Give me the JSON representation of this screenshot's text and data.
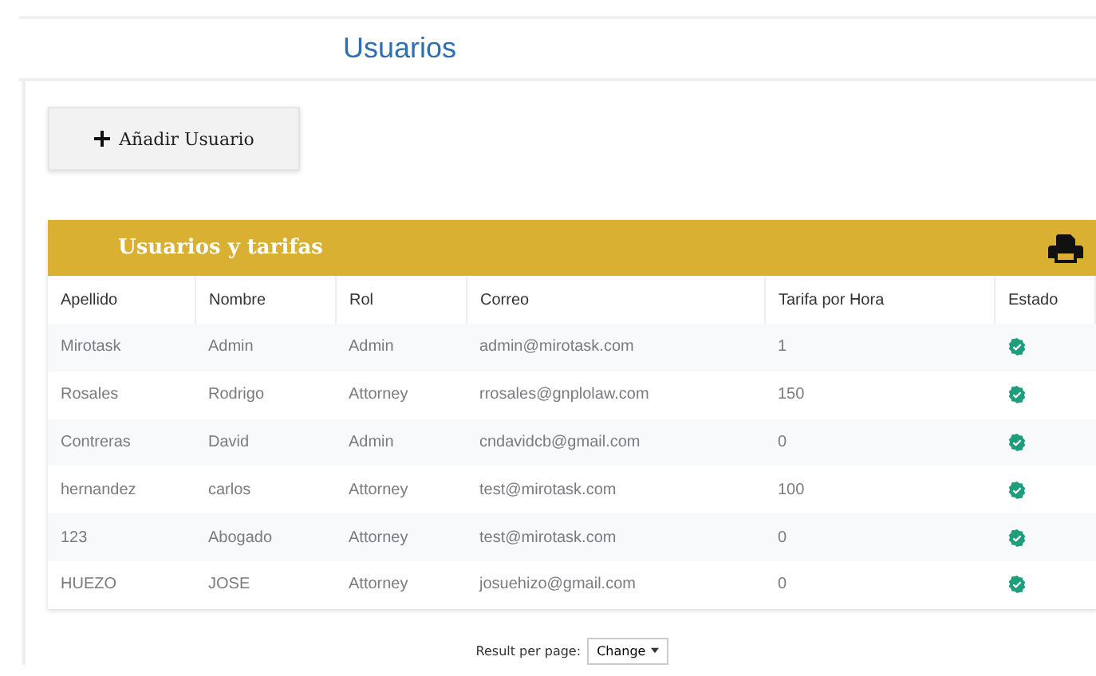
{
  "page_title": "Usuarios",
  "add_button": "Añadir Usuario",
  "panel": {
    "title": "Usuarios y tarifas",
    "columns": [
      "Apellido",
      "Nombre",
      "Rol",
      "Correo",
      "Tarifa por Hora",
      "Estado"
    ],
    "rows": [
      {
        "apellido": "Mirotask",
        "nombre": "Admin",
        "rol": "Admin",
        "correo": "admin@mirotask.com",
        "tarifa": "1",
        "active": true
      },
      {
        "apellido": "Rosales",
        "nombre": "Rodrigo",
        "rol": "Attorney",
        "correo": "rrosales@gnplolaw.com",
        "tarifa": "150",
        "active": true
      },
      {
        "apellido": "Contreras",
        "nombre": "David",
        "rol": "Admin",
        "correo": "cndavidcb@gmail.com",
        "tarifa": "0",
        "active": true
      },
      {
        "apellido": "hernandez",
        "nombre": "carlos",
        "rol": "Attorney",
        "correo": "test@mirotask.com",
        "tarifa": "100",
        "active": true
      },
      {
        "apellido": "123",
        "nombre": "Abogado",
        "rol": "Attorney",
        "correo": "test@mirotask.com",
        "tarifa": "0",
        "active": true
      },
      {
        "apellido": "HUEZO",
        "nombre": "JOSE",
        "rol": "Attorney",
        "correo": "josuehizo@gmail.com",
        "tarifa": "0",
        "active": true
      }
    ]
  },
  "pagination": {
    "label": "Result per page:",
    "button": "Change"
  }
}
